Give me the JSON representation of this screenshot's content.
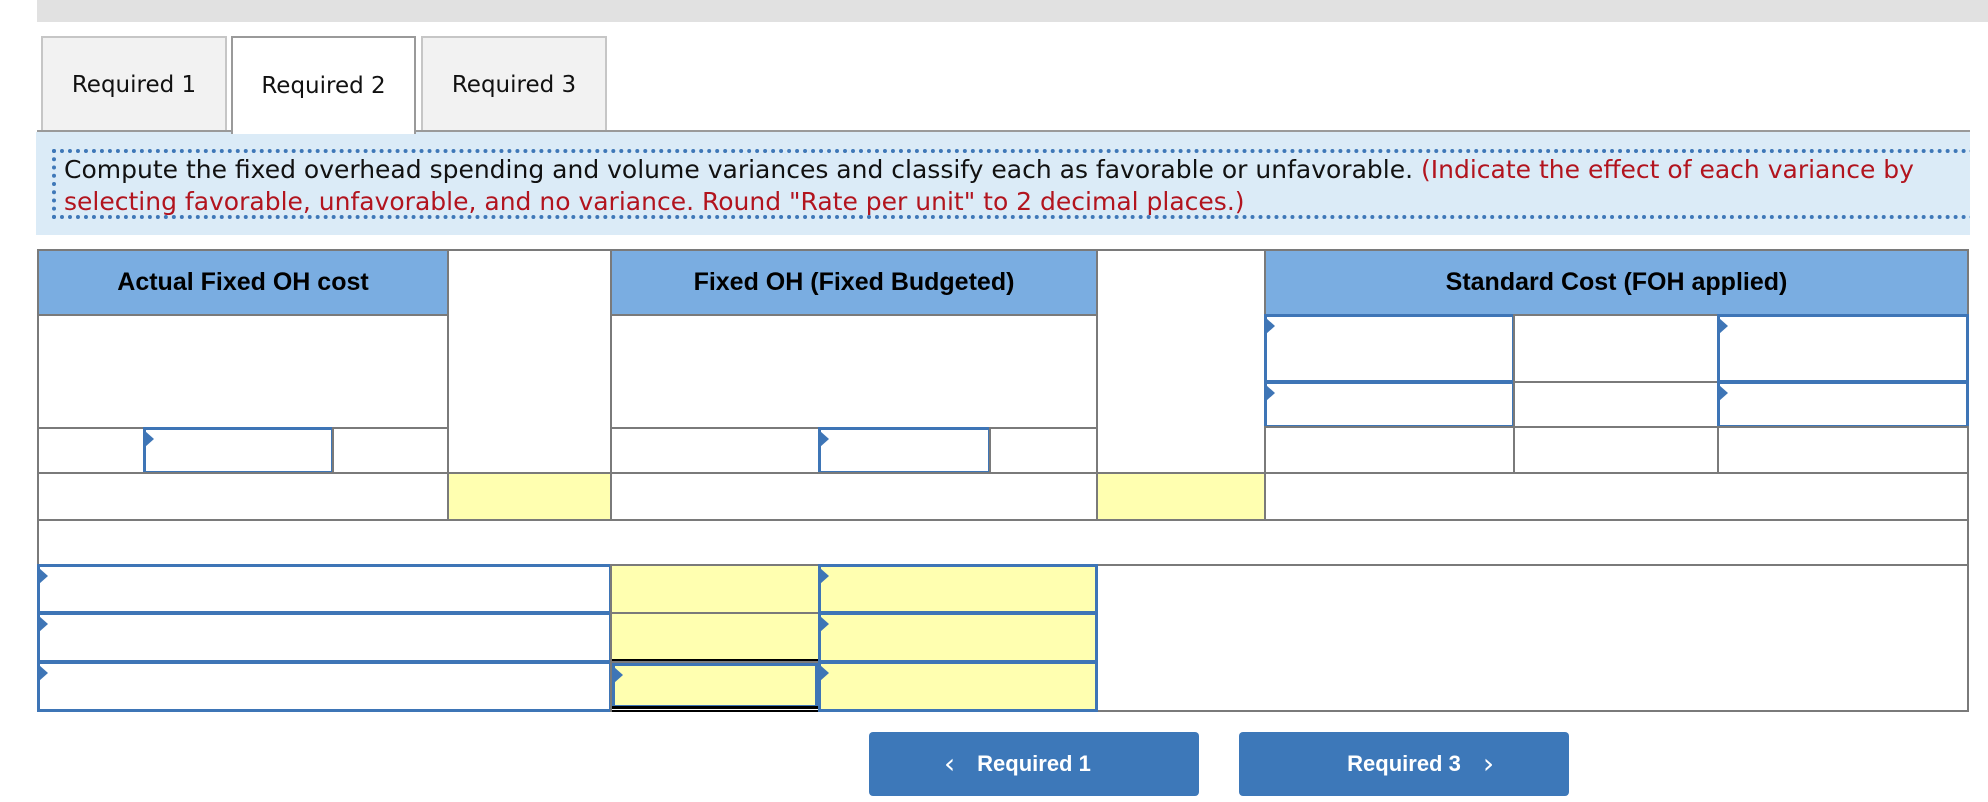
{
  "tabs": [
    {
      "label": "Required 1",
      "active": false
    },
    {
      "label": "Required 2",
      "active": true
    },
    {
      "label": "Required 3",
      "active": false
    }
  ],
  "instructions": {
    "main": "Compute the fixed overhead spending and volume variances and classify each as favorable or unfavorable. ",
    "note": "(Indicate the effect of each variance by selecting favorable, unfavorable, and no variance. Round \"Rate per unit\" to 2 decimal places.)"
  },
  "table": {
    "headers": {
      "actual": "Actual Fixed OH cost",
      "budgeted": "Fixed OH (Fixed Budgeted)",
      "standard": "Standard Cost (FOH applied)"
    },
    "inputs": {
      "actual_cost": "",
      "budgeted_cost": "",
      "std_row1_col1": "",
      "std_row1_col3": "",
      "std_row2_col1": "",
      "std_row2_col3": "",
      "variance_label_1": "",
      "variance_label_2": "",
      "variance_label_3": "",
      "variance_class_1": "",
      "variance_class_2": "",
      "variance_class_3": "",
      "variance_amount_3": ""
    }
  },
  "navigation": {
    "prev_label": "Required 1",
    "next_label": "Required 3",
    "prev_icon": "chevron-left-icon",
    "next_icon": "chevron-right-icon"
  },
  "colors": {
    "header_bg": "#7aade1",
    "instruction_bg": "#dbebf7",
    "note_text": "#b2141e",
    "input_border": "#3e75b6",
    "computed_cell_bg": "#ffffb0",
    "button_bg": "#3d78b9"
  }
}
